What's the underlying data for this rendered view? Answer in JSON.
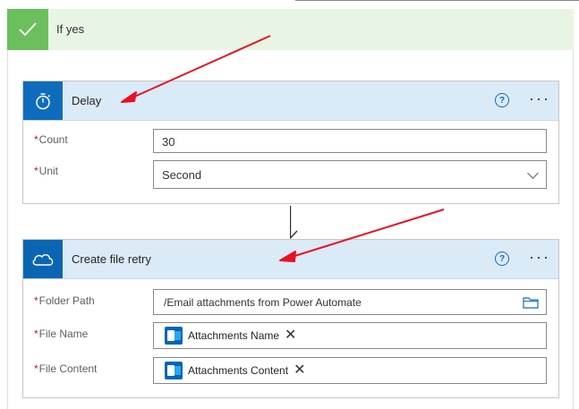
{
  "condition": {
    "title": "If yes"
  },
  "delay": {
    "title": "Delay",
    "fields": [
      {
        "label": "Count",
        "value": "30"
      },
      {
        "label": "Unit",
        "value": "Second"
      }
    ]
  },
  "create_file": {
    "title": "Create file retry",
    "fields": [
      {
        "label": "Folder Path",
        "value": "/Email attachments from Power Automate"
      },
      {
        "label": "File Name",
        "token": "Attachments Name"
      },
      {
        "label": "File Content",
        "token": "Attachments Content"
      }
    ]
  },
  "icons": {
    "condition": "checkmark-icon",
    "delay": "timer-icon",
    "create_file": "onedrive-cloud-icon",
    "help": "help-icon",
    "more": "more-options-icon",
    "token": "outlook-icon",
    "remove": "close-icon",
    "folder": "folder-icon",
    "dropdown": "chevron-down-icon"
  },
  "colors": {
    "condition_accent": "#6bbf5c",
    "action_accent": "#0f6cbd",
    "header_bg": "#dbeaf7",
    "annotation_arrow": "#e81123"
  }
}
